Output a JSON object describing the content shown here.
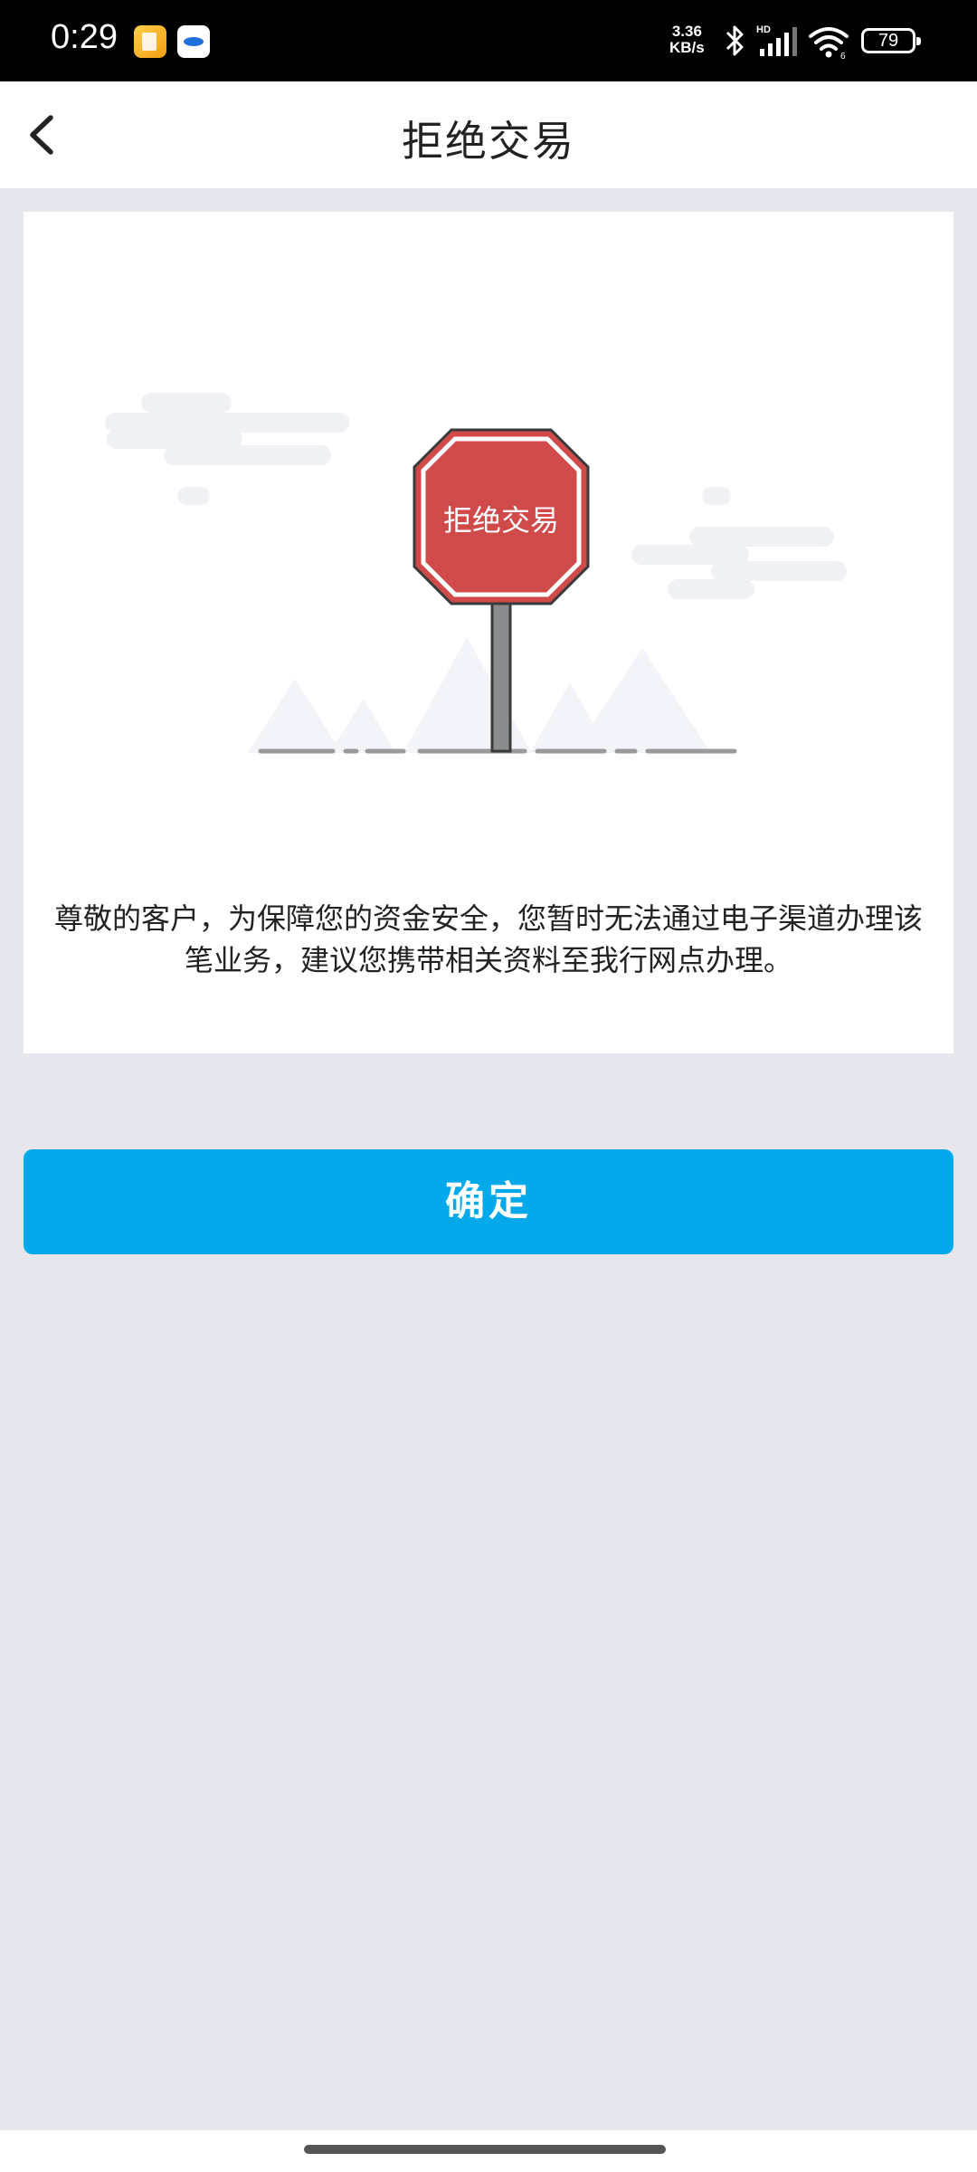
{
  "status_bar": {
    "time": "0:29",
    "net_speed_value": "3.36",
    "net_speed_unit": "KB/s",
    "battery_level": "79",
    "icons": [
      "gallery-app-icon",
      "bird-app-icon",
      "bluetooth-icon",
      "hd-signal-icon",
      "wifi-icon",
      "battery-icon"
    ]
  },
  "header": {
    "title": "拒绝交易",
    "back_icon": "chevron-left-icon"
  },
  "illustration": {
    "sign_text": "拒绝交易",
    "sign_color": "#d04a4a"
  },
  "main": {
    "notice": "尊敬的客户，为保障您的资金安全，您暂时无法通过电子渠道办理该笔业务，建议您携带相关资料至我行网点办理。"
  },
  "actions": {
    "confirm_label": "确定",
    "confirm_color": "#04a9ec"
  }
}
